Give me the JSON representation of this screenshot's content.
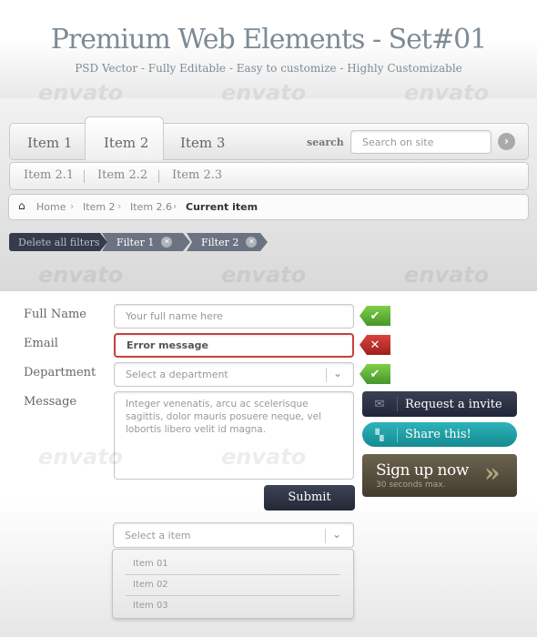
{
  "header": {
    "title": "Premium Web Elements  -  Set#01",
    "subtitle": "PSD Vector  -  Fully Editable  -  Easy to customize  -  Highly Customizable"
  },
  "watermark": "envato",
  "nav": {
    "items": [
      {
        "label": "Item 1"
      },
      {
        "label": "Item 2",
        "active": true
      },
      {
        "label": "Item 3"
      }
    ],
    "search_label": "search",
    "search_placeholder": "Search on site"
  },
  "subnav": {
    "items": [
      "Item 2.1",
      "Item 2.2",
      "Item 2.3"
    ]
  },
  "breadcrumb": {
    "items": [
      "Home",
      "Item 2",
      "Item 2.6"
    ],
    "current": "Current item"
  },
  "filters": {
    "delete_all": "Delete all filters",
    "items": [
      "Filter 1",
      "Filter 2"
    ]
  },
  "form": {
    "full_name": {
      "label": "Full Name",
      "placeholder": "Your full name here",
      "status": "valid"
    },
    "email": {
      "label": "Email",
      "value": "Error message",
      "status": "error"
    },
    "department": {
      "label": "Department",
      "placeholder": "Select a department",
      "status": "valid"
    },
    "message": {
      "label": "Message",
      "value": "Integer venenatis, arcu ac scelerisque sagittis, dolor mauris posuere neque, vel lobortis libero velit id magna."
    },
    "submit": "Submit"
  },
  "buttons": {
    "request": "Request a invite",
    "share": "Share this!",
    "signup": "Sign up now",
    "signup_sub": "30 seconds max."
  },
  "dropdown": {
    "placeholder": "Select a item",
    "options": [
      "Item 01",
      "Item 02",
      "Item 03"
    ]
  },
  "colors": {
    "dark": "#2e3342",
    "teal": "#1b9fa6",
    "olive": "#5a5140",
    "valid": "#5bb336",
    "error": "#c0302c",
    "title": "#7d8b96"
  }
}
